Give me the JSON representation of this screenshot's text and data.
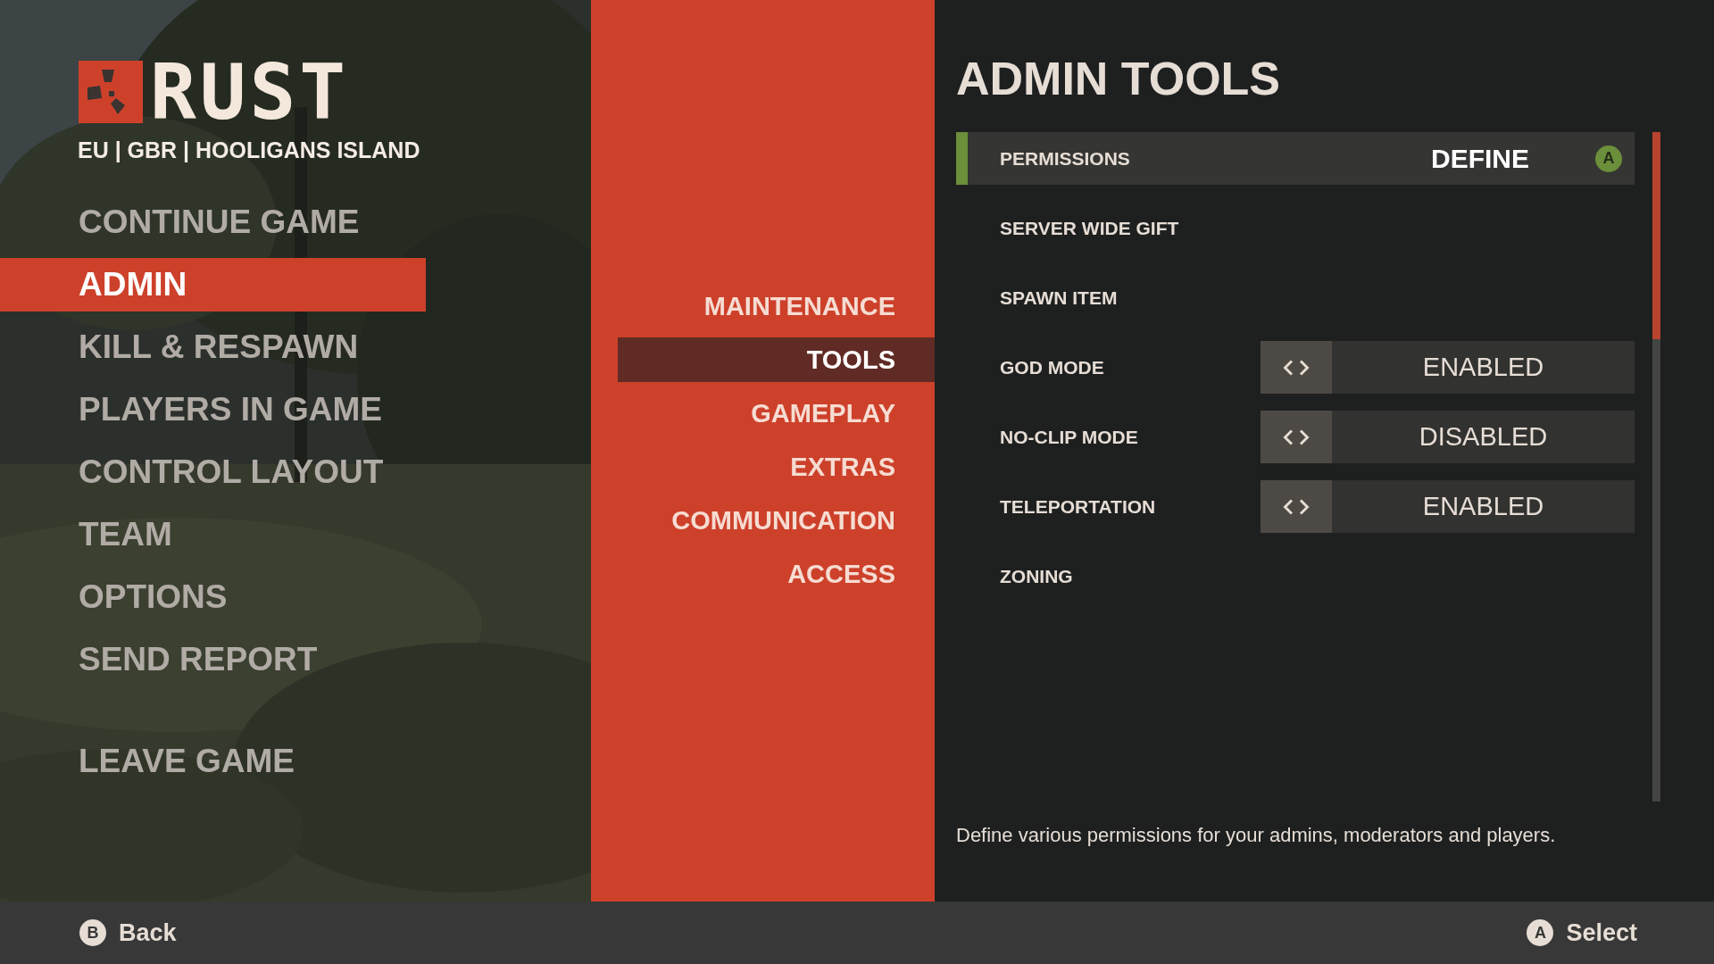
{
  "logo": {
    "text": "RUST"
  },
  "server": "EU | GBR | HOOLIGANS ISLAND",
  "main_menu": [
    {
      "label": "CONTINUE GAME",
      "selected": false
    },
    {
      "label": "ADMIN",
      "selected": true
    },
    {
      "label": "KILL & RESPAWN",
      "selected": false
    },
    {
      "label": "PLAYERS IN GAME",
      "selected": false
    },
    {
      "label": "CONTROL LAYOUT",
      "selected": false
    },
    {
      "label": "TEAM",
      "selected": false
    },
    {
      "label": "OPTIONS",
      "selected": false
    },
    {
      "label": "SEND REPORT",
      "selected": false
    },
    {
      "label": "LEAVE GAME",
      "selected": false
    }
  ],
  "sub_menu": [
    {
      "label": "MAINTENANCE",
      "selected": false
    },
    {
      "label": "TOOLS",
      "selected": true
    },
    {
      "label": "GAMEPLAY",
      "selected": false
    },
    {
      "label": "EXTRAS",
      "selected": false
    },
    {
      "label": "COMMUNICATION",
      "selected": false
    },
    {
      "label": "ACCESS",
      "selected": false
    }
  ],
  "panel": {
    "title": "ADMIN TOOLS",
    "rows": [
      {
        "kind": "action",
        "label": "PERMISSIONS",
        "value": "DEFINE",
        "button": "A",
        "selected": true
      },
      {
        "kind": "action",
        "label": "SERVER WIDE GIFT",
        "selected": false
      },
      {
        "kind": "action",
        "label": "SPAWN ITEM",
        "selected": false
      },
      {
        "kind": "toggle",
        "label": "GOD MODE",
        "value": "ENABLED",
        "selected": false
      },
      {
        "kind": "toggle",
        "label": "NO-CLIP MODE",
        "value": "DISABLED",
        "selected": false
      },
      {
        "kind": "toggle",
        "label": "TELEPORTATION",
        "value": "ENABLED",
        "selected": false
      },
      {
        "kind": "action",
        "label": "ZONING",
        "selected": false
      }
    ],
    "description": "Define various permissions for your admins, moderators and players."
  },
  "footer": [
    {
      "button": "B",
      "label": "Back"
    },
    {
      "button": "A",
      "label": "Select"
    }
  ]
}
